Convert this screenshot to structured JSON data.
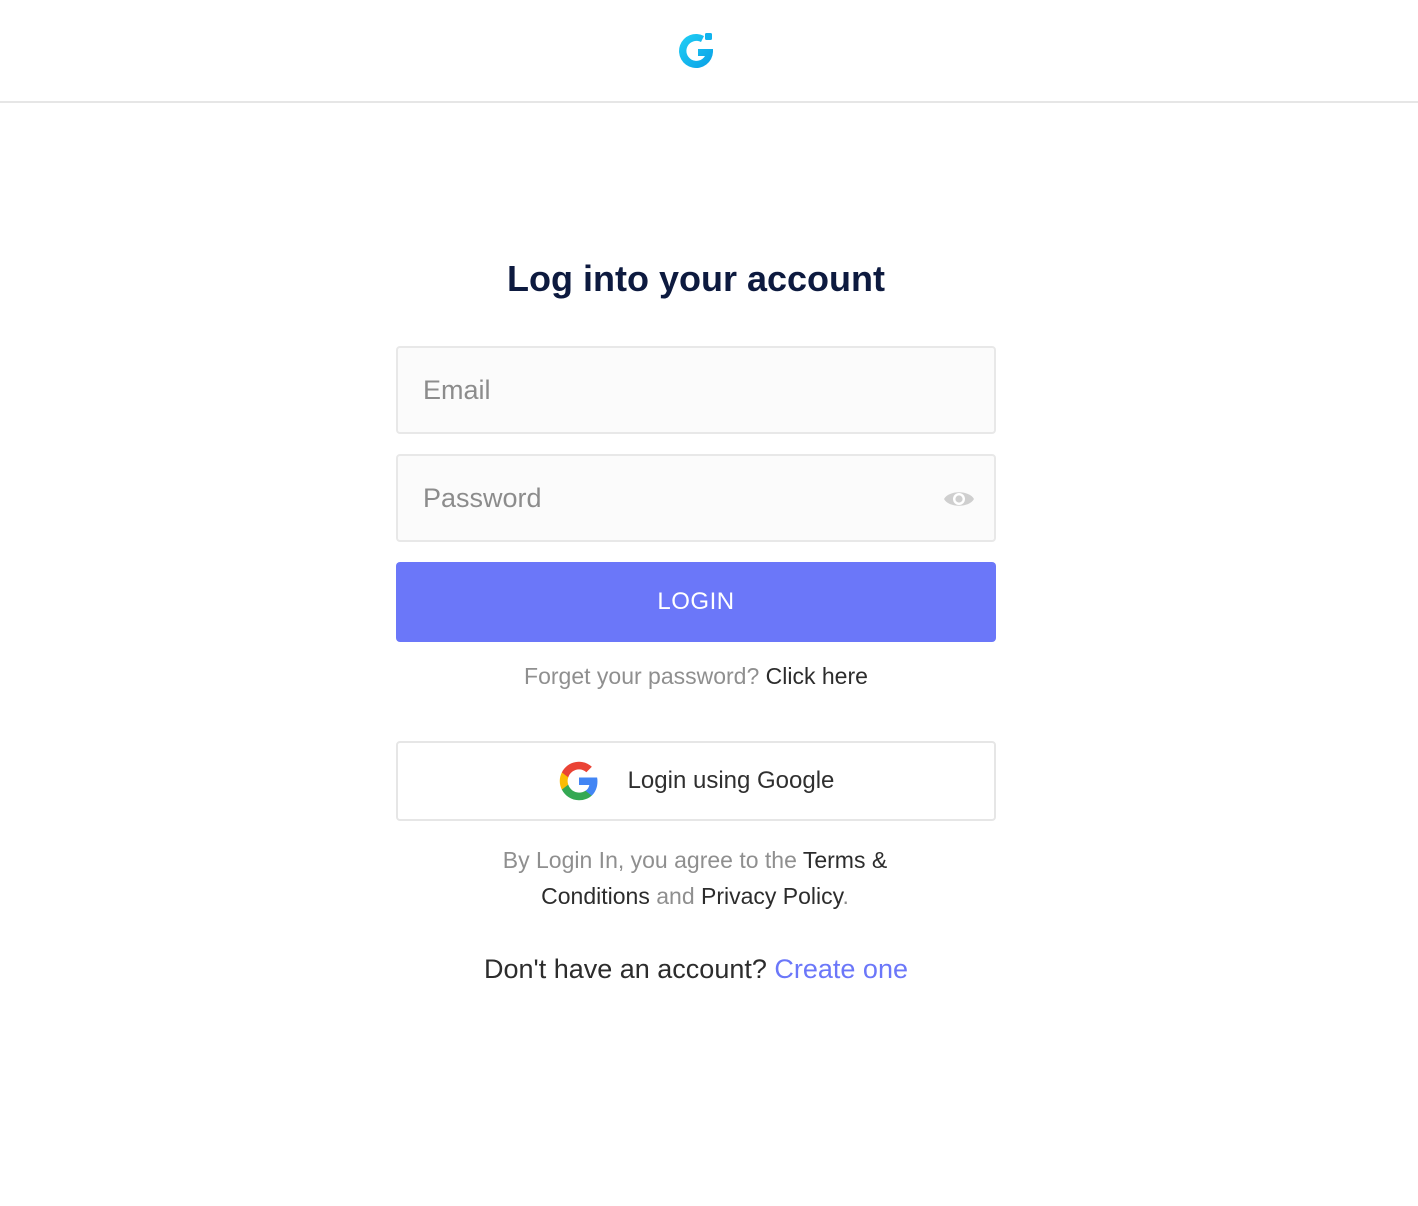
{
  "header": {
    "logo_icon": "brand-g-logo",
    "brand_color": "#14bff0"
  },
  "login": {
    "title": "Log into your account",
    "email_placeholder": "Email",
    "email_value": "",
    "password_placeholder": "Password",
    "password_value": "",
    "password_toggle_icon": "eye-icon",
    "submit_label": "LOGIN",
    "accent_color": "#6b77f9",
    "forgot_prefix": "Forget your password?",
    "forgot_link": "Click here",
    "google_label": "Login using Google",
    "google_icon": "google-icon"
  },
  "terms": {
    "prefix": "By Login In, you agree to the",
    "terms_link": "Terms & Conditions",
    "conjunction": "and",
    "privacy_link": "Privacy Policy",
    "suffix": "."
  },
  "signup": {
    "prefix": "Don't have an account?",
    "link": "Create one"
  }
}
